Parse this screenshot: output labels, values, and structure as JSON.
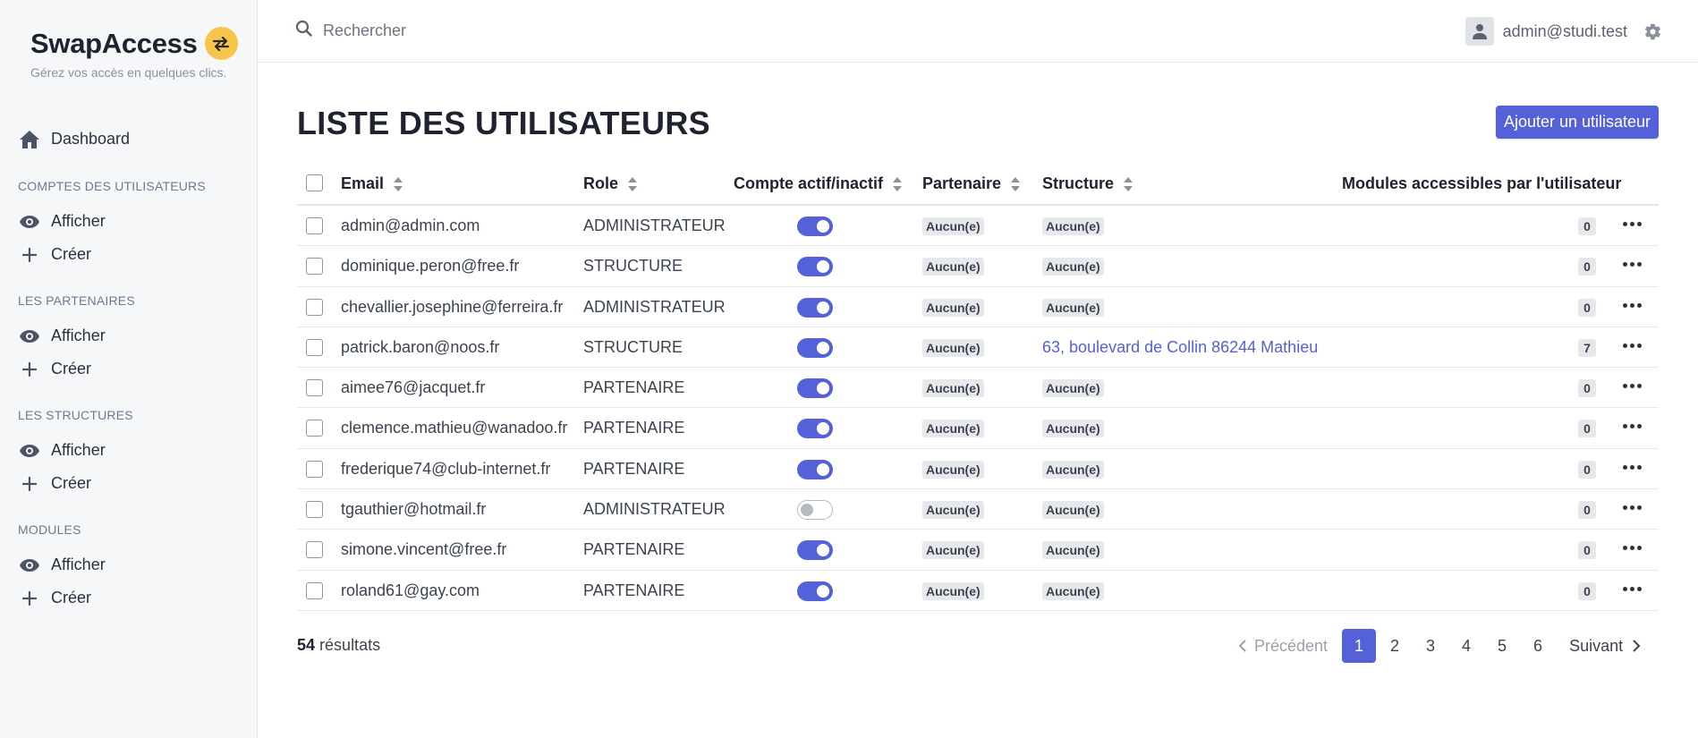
{
  "app": {
    "name": "SwapAccess",
    "tagline": "Gérez vos accès en quelques clics.",
    "accent_color": "#5461d9",
    "logo_badge_color": "#f6c549"
  },
  "sidebar": {
    "dashboard": {
      "label": "Dashboard",
      "icon": "home-icon"
    },
    "sections": [
      {
        "title": "COMPTES DES UTILISATEURS",
        "items": [
          {
            "label": "Afficher",
            "icon": "eye-icon"
          },
          {
            "label": "Créer",
            "icon": "plus-icon"
          }
        ]
      },
      {
        "title": "LES PARTENAIRES",
        "items": [
          {
            "label": "Afficher",
            "icon": "eye-icon"
          },
          {
            "label": "Créer",
            "icon": "plus-icon"
          }
        ]
      },
      {
        "title": "LES STRUCTURES",
        "items": [
          {
            "label": "Afficher",
            "icon": "eye-icon"
          },
          {
            "label": "Créer",
            "icon": "plus-icon"
          }
        ]
      },
      {
        "title": "MODULES",
        "items": [
          {
            "label": "Afficher",
            "icon": "eye-icon"
          },
          {
            "label": "Créer",
            "icon": "plus-icon"
          }
        ]
      }
    ]
  },
  "header": {
    "search_placeholder": "Rechercher",
    "user_email": "admin@studi.test"
  },
  "main": {
    "title": "LISTE DES UTILISATEURS",
    "add_button": "Ajouter un utilisateur",
    "columns": {
      "email": "Email",
      "role": "Role",
      "active": "Compte actif/inactif",
      "partner": "Partenaire",
      "structure": "Structure",
      "modules": "Modules accessibles par l'utilisateur"
    },
    "rows": [
      {
        "email": "admin@admin.com",
        "role": "ADMINISTRATEUR",
        "active": true,
        "partner": "Aucun(e)",
        "structure": "Aucun(e)",
        "structure_link": false,
        "modules": "0"
      },
      {
        "email": "dominique.peron@free.fr",
        "role": "STRUCTURE",
        "active": true,
        "partner": "Aucun(e)",
        "structure": "Aucun(e)",
        "structure_link": false,
        "modules": "0"
      },
      {
        "email": "chevallier.josephine@ferreira.fr",
        "role": "ADMINISTRATEUR",
        "active": true,
        "partner": "Aucun(e)",
        "structure": "Aucun(e)",
        "structure_link": false,
        "modules": "0"
      },
      {
        "email": "patrick.baron@noos.fr",
        "role": "STRUCTURE",
        "active": true,
        "partner": "Aucun(e)",
        "structure": "63, boulevard de Collin 86244 Mathieu",
        "structure_link": true,
        "modules": "7"
      },
      {
        "email": "aimee76@jacquet.fr",
        "role": "PARTENAIRE",
        "active": true,
        "partner": "Aucun(e)",
        "structure": "Aucun(e)",
        "structure_link": false,
        "modules": "0"
      },
      {
        "email": "clemence.mathieu@wanadoo.fr",
        "role": "PARTENAIRE",
        "active": true,
        "partner": "Aucun(e)",
        "structure": "Aucun(e)",
        "structure_link": false,
        "modules": "0"
      },
      {
        "email": "frederique74@club-internet.fr",
        "role": "PARTENAIRE",
        "active": true,
        "partner": "Aucun(e)",
        "structure": "Aucun(e)",
        "structure_link": false,
        "modules": "0"
      },
      {
        "email": "tgauthier@hotmail.fr",
        "role": "ADMINISTRATEUR",
        "active": false,
        "partner": "Aucun(e)",
        "structure": "Aucun(e)",
        "structure_link": false,
        "modules": "0"
      },
      {
        "email": "simone.vincent@free.fr",
        "role": "PARTENAIRE",
        "active": true,
        "partner": "Aucun(e)",
        "structure": "Aucun(e)",
        "structure_link": false,
        "modules": "0"
      },
      {
        "email": "roland61@gay.com",
        "role": "PARTENAIRE",
        "active": true,
        "partner": "Aucun(e)",
        "structure": "Aucun(e)",
        "structure_link": false,
        "modules": "0"
      }
    ],
    "results_count": "54",
    "results_label": "résultats",
    "pagination": {
      "prev": "Précédent",
      "next": "Suivant",
      "pages": [
        "1",
        "2",
        "3",
        "4",
        "5",
        "6"
      ],
      "current": "1"
    }
  }
}
